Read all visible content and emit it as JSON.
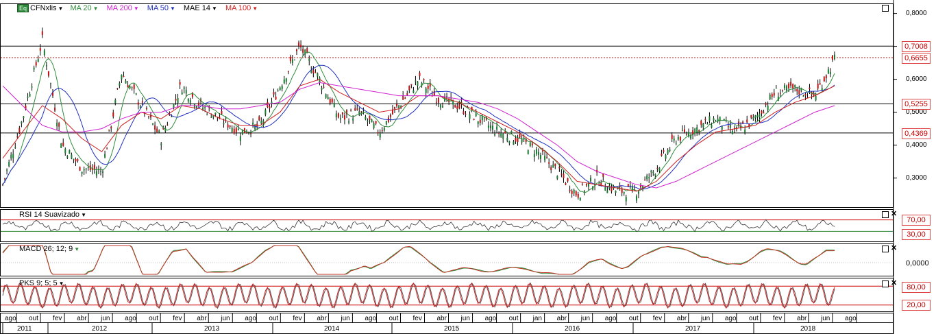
{
  "toolbar": {
    "symbol": "CFNxlis",
    "eq_badge": "Eq",
    "indicators": [
      {
        "label": "MA 20",
        "color": "#2e8b3a"
      },
      {
        "label": "MA 200",
        "color": "#d020d0"
      },
      {
        "label": "MA 50",
        "color": "#2030c0"
      },
      {
        "label": "MAE 14",
        "color": "#000000"
      },
      {
        "label": "MA 100",
        "color": "#d02020"
      }
    ]
  },
  "price_axis": {
    "ticks": [
      "0,8000",
      "0,7000",
      "0,6000",
      "0,5000",
      "0,4000",
      "0,3000"
    ],
    "tags": [
      "0,7008",
      "0,6655",
      "0,5255",
      "0,4369"
    ]
  },
  "panels": {
    "rsi": {
      "label": "RSI 14 Suavizado",
      "levels": [
        "70,00",
        "30,00"
      ]
    },
    "macd": {
      "label": "MACD 26; 12; 9",
      "levels": [
        "0,0000"
      ]
    },
    "pks": {
      "label": "PKS 9; 5; 5",
      "levels": [
        "80,00",
        "20,00"
      ]
    }
  },
  "x_axis": {
    "months": [
      "ago",
      "out",
      "fev",
      "abr",
      "jun",
      "ago",
      "out",
      "fev",
      "abr",
      "jun",
      "ago",
      "out",
      "fev",
      "abr",
      "jun",
      "ago",
      "out",
      "fev",
      "abr",
      "jun",
      "ago",
      "out",
      "jan",
      "abr",
      "jun",
      "ago",
      "out",
      "fev",
      "abr",
      "jun",
      "ago",
      "out",
      "fev",
      "abr",
      "jun",
      "ago"
    ],
    "years": [
      "2011",
      "2012",
      "2013",
      "2014",
      "2015",
      "2016",
      "2017",
      "2018"
    ]
  },
  "chart_data": {
    "type": "line",
    "title": "CFNxlis",
    "x": [
      "2011-08",
      "2011-10",
      "2011-12",
      "2012-02",
      "2012-04",
      "2012-06",
      "2012-08",
      "2012-10",
      "2012-12",
      "2013-02",
      "2013-04",
      "2013-06",
      "2013-08",
      "2013-10",
      "2013-12",
      "2014-02",
      "2014-04",
      "2014-06",
      "2014-08",
      "2014-10",
      "2014-12",
      "2015-02",
      "2015-04",
      "2015-06",
      "2015-08",
      "2015-10",
      "2015-12",
      "2016-02",
      "2016-04",
      "2016-06",
      "2016-08",
      "2016-10",
      "2016-12",
      "2017-02",
      "2017-04",
      "2017-06",
      "2017-08",
      "2017-10",
      "2017-12",
      "2018-02",
      "2018-04",
      "2018-06",
      "2018-08"
    ],
    "series": [
      {
        "name": "CFNxlis",
        "values": [
          0.28,
          0.48,
          0.72,
          0.4,
          0.33,
          0.32,
          0.62,
          0.52,
          0.42,
          0.58,
          0.52,
          0.48,
          0.44,
          0.46,
          0.58,
          0.7,
          0.6,
          0.48,
          0.5,
          0.44,
          0.52,
          0.6,
          0.54,
          0.52,
          0.48,
          0.44,
          0.42,
          0.38,
          0.32,
          0.25,
          0.3,
          0.26,
          0.26,
          0.33,
          0.42,
          0.45,
          0.48,
          0.44,
          0.48,
          0.56,
          0.57,
          0.55,
          0.66
        ]
      },
      {
        "name": "MA 200",
        "values": [
          0.58,
          0.52,
          0.46,
          0.44,
          0.44,
          0.45,
          0.48,
          0.5,
          0.5,
          0.52,
          0.52,
          0.51,
          0.51,
          0.52,
          0.53,
          0.57,
          0.59,
          0.58,
          0.57,
          0.56,
          0.55,
          0.55,
          0.55,
          0.54,
          0.53,
          0.51,
          0.48,
          0.44,
          0.4,
          0.35,
          0.32,
          0.3,
          0.28,
          0.27,
          0.29,
          0.32,
          0.35,
          0.38,
          0.41,
          0.44,
          0.47,
          0.5,
          0.52
        ]
      },
      {
        "name": "MA 100",
        "values": [
          0.36,
          0.44,
          0.52,
          0.48,
          0.42,
          0.38,
          0.46,
          0.5,
          0.48,
          0.52,
          0.51,
          0.48,
          0.46,
          0.46,
          0.5,
          0.58,
          0.6,
          0.56,
          0.53,
          0.5,
          0.51,
          0.55,
          0.55,
          0.53,
          0.5,
          0.47,
          0.44,
          0.4,
          0.35,
          0.29,
          0.28,
          0.27,
          0.26,
          0.29,
          0.35,
          0.4,
          0.44,
          0.45,
          0.46,
          0.5,
          0.53,
          0.55,
          0.58
        ]
      }
    ],
    "ylim": [
      0.22,
      0.82
    ],
    "grid": false,
    "legend": "top-left",
    "levels": [
      0.7008,
      0.6655,
      0.5255,
      0.4369
    ],
    "rsi_levels": [
      70,
      30
    ],
    "pks_levels": [
      80,
      20
    ]
  }
}
